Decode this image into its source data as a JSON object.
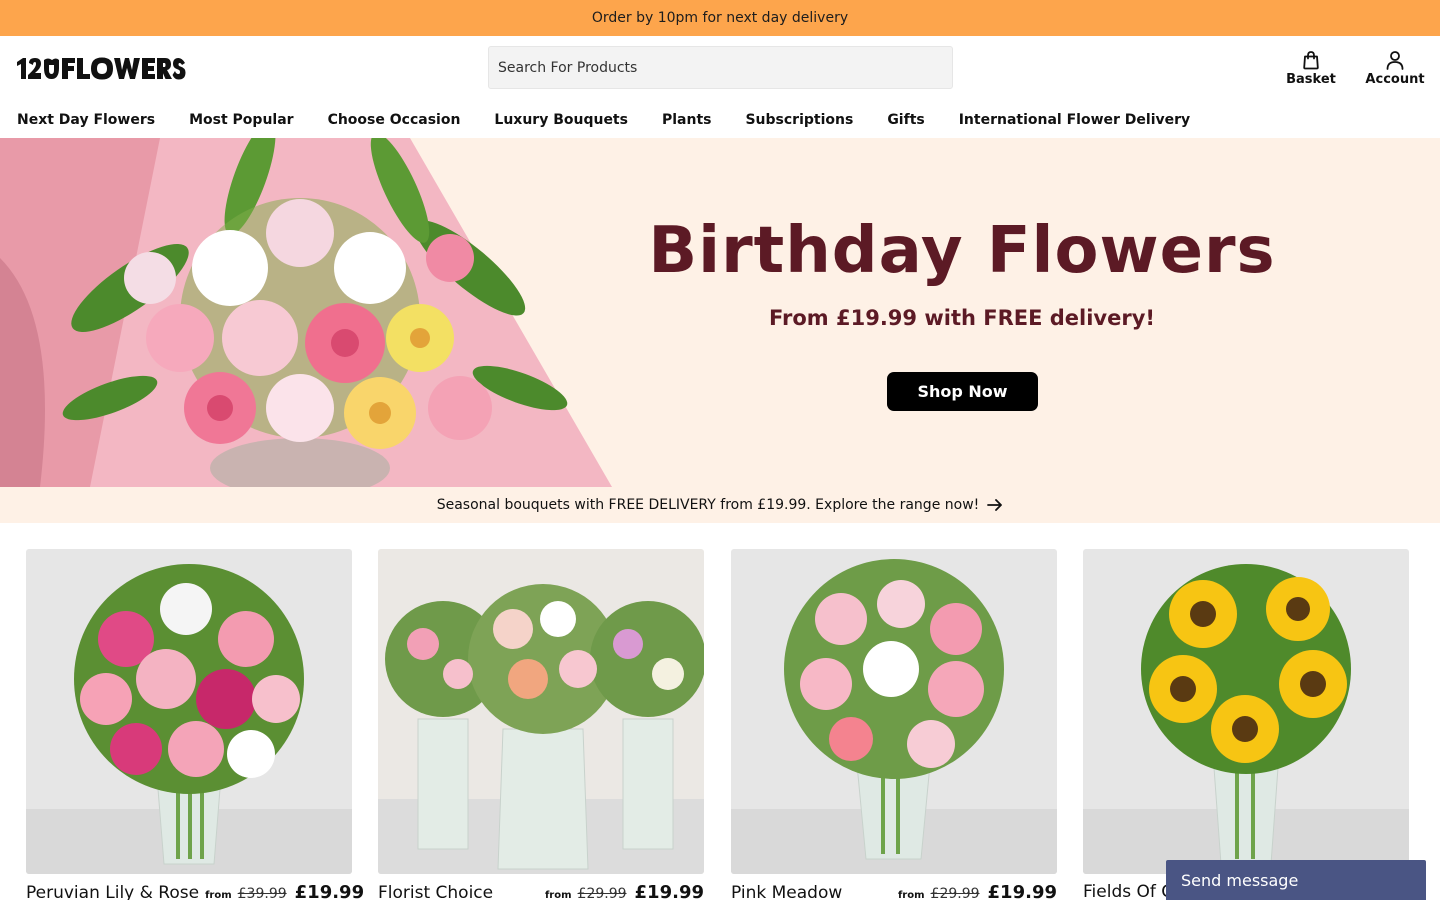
{
  "topbar": {
    "text": "Order by 10pm for next day delivery"
  },
  "header": {
    "logo_text": "123FLOWERS",
    "search_placeholder": "Search For Products",
    "basket_label": "Basket",
    "account_label": "Account"
  },
  "nav": {
    "items": [
      "Next Day Flowers",
      "Most Popular",
      "Choose Occasion",
      "Luxury Bouquets",
      "Plants",
      "Subscriptions",
      "Gifts",
      "International Flower Delivery"
    ]
  },
  "hero": {
    "title": "Birthday Flowers",
    "subtitle": "From £19.99 with FREE delivery!",
    "button_label": "Shop Now"
  },
  "promo": {
    "text": "Seasonal bouquets with FREE DELIVERY from £19.99. Explore the range now!"
  },
  "products": [
    {
      "name": "Peruvian Lily & Rose",
      "from": "from",
      "was": "£39.99",
      "price": "£19.99"
    },
    {
      "name": "Florist Choice",
      "from": "from",
      "was": "£29.99",
      "price": "£19.99"
    },
    {
      "name": "Pink Meadow",
      "from": "from",
      "was": "£29.99",
      "price": "£19.99"
    },
    {
      "name": "Fields Of G",
      "from": "",
      "was": "",
      "price": ""
    }
  ],
  "chat": {
    "label": "Send message"
  },
  "colors": {
    "topbar": "#fda54c",
    "hero_bg": "#fef1e6",
    "hero_text": "#5c1a25",
    "chat": "#4a5584"
  }
}
